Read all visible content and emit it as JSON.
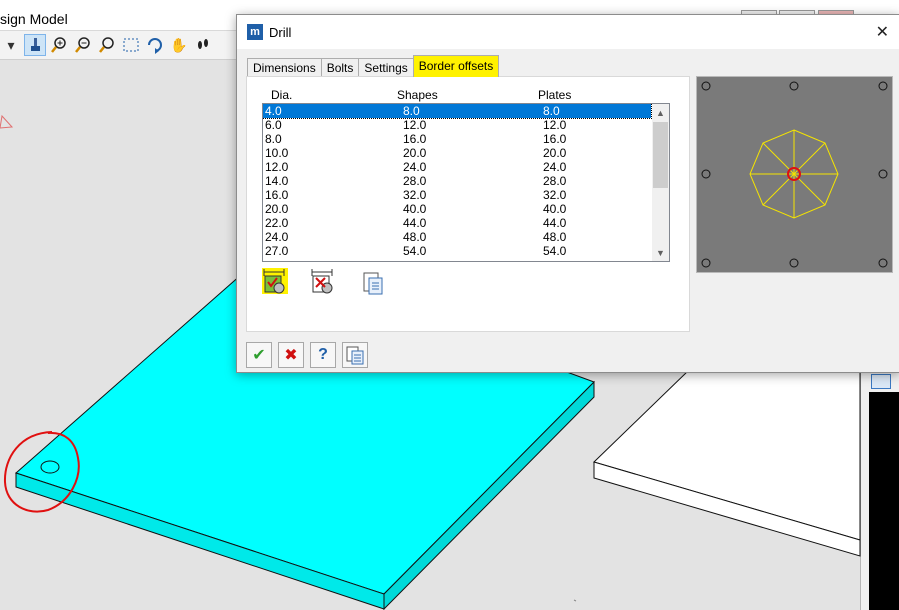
{
  "background_app": {
    "title": "sign Model"
  },
  "dialog": {
    "title": "Drill",
    "app_icon": "app-logo-icon",
    "close_glyph": "✕",
    "tabs": [
      {
        "label": "Dimensions",
        "selected": false
      },
      {
        "label": "Bolts",
        "selected": false
      },
      {
        "label": "Settings",
        "selected": false
      },
      {
        "label": "Border offsets",
        "selected": true
      }
    ],
    "table": {
      "columns": [
        "Dia.",
        "Shapes",
        "Plates"
      ],
      "rows": [
        [
          "4.0",
          "8.0",
          "8.0"
        ],
        [
          "6.0",
          "12.0",
          "12.0"
        ],
        [
          "8.0",
          "16.0",
          "16.0"
        ],
        [
          "10.0",
          "20.0",
          "20.0"
        ],
        [
          "12.0",
          "24.0",
          "24.0"
        ],
        [
          "14.0",
          "28.0",
          "28.0"
        ],
        [
          "16.0",
          "32.0",
          "32.0"
        ],
        [
          "20.0",
          "40.0",
          "40.0"
        ],
        [
          "22.0",
          "44.0",
          "44.0"
        ],
        [
          "24.0",
          "48.0",
          "48.0"
        ],
        [
          "27.0",
          "54.0",
          "54.0"
        ]
      ],
      "selected_row": 0
    },
    "tool_buttons": [
      {
        "icon": "border-offset-shape-icon"
      },
      {
        "icon": "border-offset-remove-icon"
      },
      {
        "icon": "copy-document-icon"
      }
    ],
    "footer_buttons": [
      {
        "icon": "ok-check-icon",
        "glyph": "✔",
        "color": "#2e9e2e"
      },
      {
        "icon": "cancel-x-icon",
        "glyph": "✖",
        "color": "#d01010"
      },
      {
        "icon": "help-question-icon",
        "glyph": "?",
        "color": "#1f5fa8"
      },
      {
        "icon": "copy-document-icon"
      }
    ]
  },
  "colors": {
    "accent_highlight": "#fff200",
    "selection": "#0078d7",
    "plate_cyan": "#00ffff",
    "preview_bg": "#7a7a7a",
    "preview_shape": "#f5e400",
    "preview_center": "#e01010",
    "markup_red": "#e01010"
  }
}
